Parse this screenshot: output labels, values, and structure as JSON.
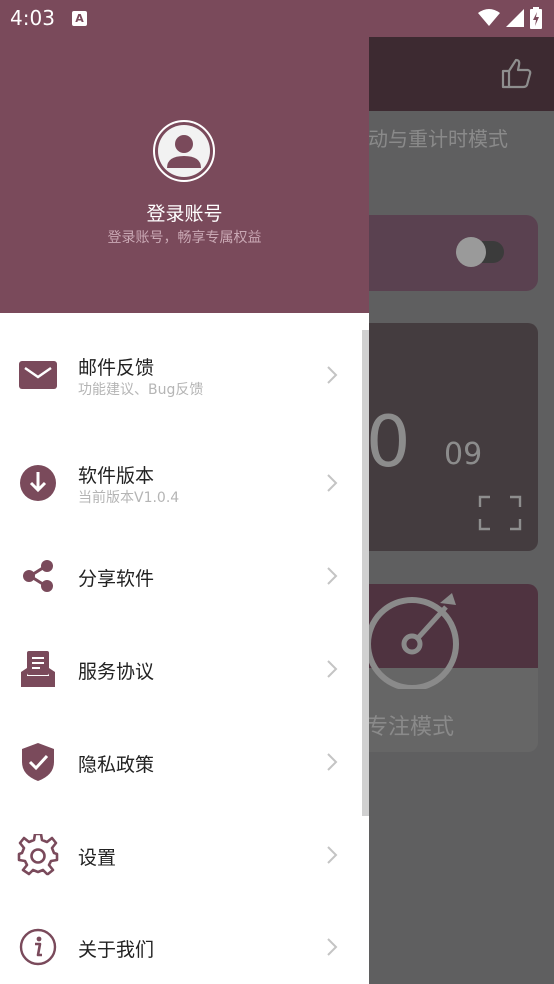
{
  "status_bar": {
    "time": "4:03",
    "notification_glyph": "A"
  },
  "background_app": {
    "toolbar_icon": "thumbs-up-icon",
    "mode_text": "动与重计时模式",
    "timer_minutes_partial": "0",
    "timer_seconds": "09",
    "focus_label": "专注模式"
  },
  "drawer": {
    "header": {
      "avatar_icon": "user-avatar-icon",
      "title": "登录账号",
      "subtitle": "登录账号，畅享专属权益"
    },
    "items": [
      {
        "label": "邮件反馈",
        "sublabel": "功能建议、Bug反馈",
        "icon": "mail-icon"
      },
      {
        "label": "软件版本",
        "sublabel": "当前版本V1.0.4",
        "icon": "download-icon"
      },
      {
        "label": "分享软件",
        "icon": "share-icon"
      },
      {
        "label": "服务协议",
        "icon": "agreement-icon"
      },
      {
        "label": "隐私政策",
        "icon": "shield-check-icon"
      },
      {
        "label": "设置",
        "icon": "gear-icon"
      },
      {
        "label": "关于我们",
        "icon": "info-icon"
      }
    ]
  },
  "colors": {
    "primary": "#7a4a5b",
    "menu_text": "#222222",
    "sub_text": "#b5b5b5",
    "chevron": "#c4c4c4"
  }
}
